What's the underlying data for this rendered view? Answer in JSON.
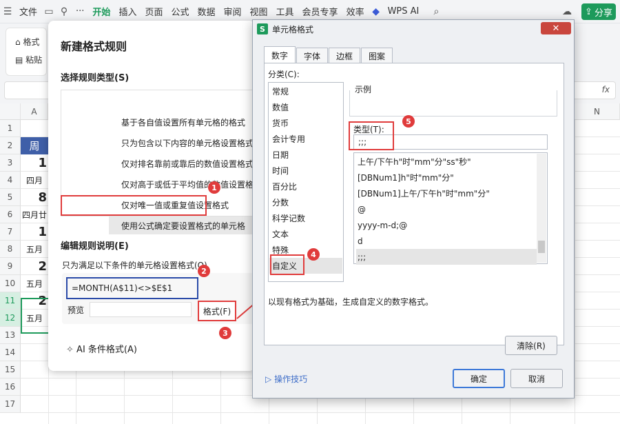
{
  "menubar": {
    "file": "文件",
    "more": "···",
    "tabs": [
      "开始",
      "插入",
      "页面",
      "公式",
      "数据",
      "审阅",
      "视图",
      "工具",
      "会员专享",
      "效率"
    ],
    "wps_ai": "WPS AI",
    "share": "分享"
  },
  "toolbar": {
    "format_painter": "格式",
    "paste": "粘贴"
  },
  "sheet": {
    "col_a": "A",
    "col_n": "N",
    "rows": [
      "1",
      "2",
      "3",
      "4",
      "5",
      "6",
      "7",
      "8",
      "9",
      "10",
      "11",
      "12",
      "13",
      "14",
      "15",
      "16",
      "17"
    ],
    "cells": [
      {
        "row": 2,
        "text": "周"
      },
      {
        "row": 3,
        "text": "1"
      },
      {
        "row": 4,
        "text": "四月"
      },
      {
        "row": 5,
        "text": "8"
      },
      {
        "row": 6,
        "text": "四月廿"
      },
      {
        "row": 7,
        "text": "1"
      },
      {
        "row": 8,
        "text": "五月"
      },
      {
        "row": 9,
        "text": "2"
      },
      {
        "row": 10,
        "text": "五月"
      },
      {
        "row": 11,
        "text": "2"
      },
      {
        "row": 12,
        "text": "五月"
      }
    ]
  },
  "rule_dialog": {
    "title": "新建格式规则",
    "select_type_label": "选择规则类型(S)",
    "rule_types": [
      "基于各自值设置所有单元格的格式",
      "只为包含以下内容的单元格设置格式",
      "仅对排名靠前或靠后的数值设置格式",
      "仅对高于或低于平均值的数值设置格式",
      "仅对唯一值或重复值设置格式",
      "使用公式确定要设置格式的单元格"
    ],
    "edit_label": "编辑规则说明(E)",
    "condition_label": "只为满足以下条件的单元格设置格式(O)",
    "formula": "=MONTH(A$11)<>$E$1",
    "preview_label": "预览",
    "format_button": "格式(F)",
    "ai_link": "AI 条件格式(A)"
  },
  "format_dialog": {
    "title": "单元格格式",
    "close": "✕",
    "tabs": [
      "数字",
      "字体",
      "边框",
      "图案"
    ],
    "category_label": "分类(C):",
    "categories": [
      "常规",
      "数值",
      "货币",
      "会计专用",
      "日期",
      "时间",
      "百分比",
      "分数",
      "科学记数",
      "文本",
      "特殊",
      "自定义"
    ],
    "sample_label": "示例",
    "type_label": "类型(T):",
    "type_value": ";;;",
    "type_list": [
      "上午/下午h\"时\"mm\"分\"ss\"秒\"",
      "[DBNum1]h\"时\"mm\"分\"",
      "[DBNum1]上午/下午h\"时\"mm\"分\"",
      "@",
      "yyyy-m-d;@",
      "d",
      ";;;"
    ],
    "description": "以现有格式为基础，生成自定义的数字格式。",
    "clear_button": "清除(R)",
    "tips_link": "操作技巧",
    "ok_button": "确定",
    "cancel_button": "取消"
  },
  "badges": [
    "1",
    "2",
    "3",
    "4",
    "5"
  ],
  "colors": {
    "accent": "#1d9a5b",
    "annotation": "#e03b3b",
    "formula_box": "#2a4aa8"
  }
}
